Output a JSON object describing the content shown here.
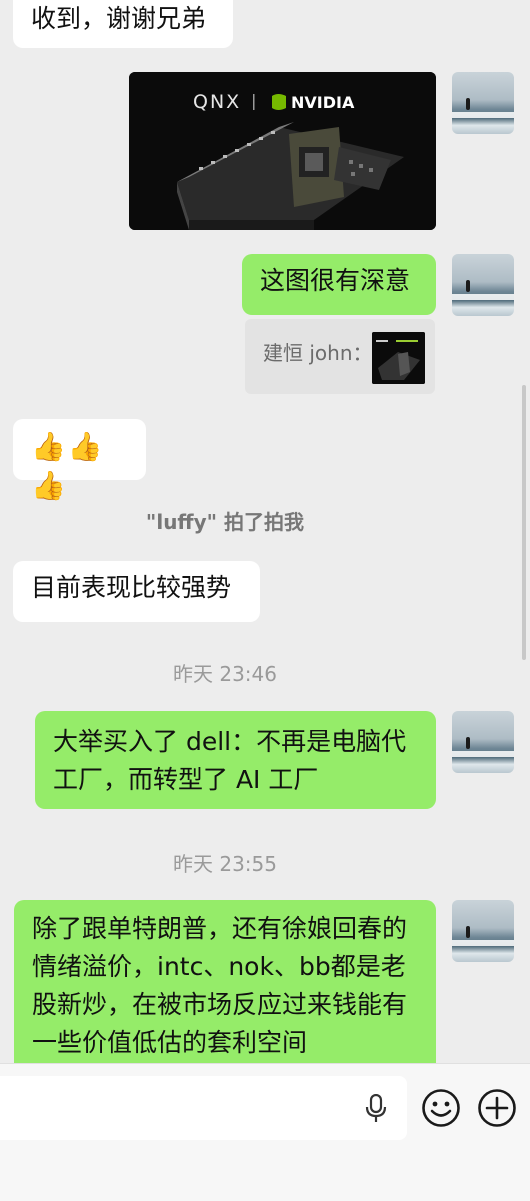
{
  "messages": {
    "m1_text": "收到，谢谢兄弟",
    "image_msg": {
      "logo_left": "QNX",
      "logo_right": "NVIDIA"
    },
    "m2_text": "这图很有深意",
    "quote_text": "建恒 john：",
    "m3_emoji": "👍👍👍",
    "system_pat": "\"luffy\" 拍了拍我",
    "m4_text": "目前表现比较强势",
    "time1": "昨天 23:46",
    "m5_text": "大举买入了 dell：不再是电脑代工厂，而转型了 AI 工厂",
    "time2": "昨天 23:55",
    "m6_text": "除了跟单特朗普，还有徐娘回春的情绪溢价，intc、nok、bb都是老股新炒，在被市场反应过来钱能有一些价值低估的套利空间"
  },
  "input": {
    "icons": [
      "microphone-icon",
      "emoji-icon",
      "plus-icon"
    ]
  },
  "colors": {
    "background": "#ededed",
    "sent_bubble": "#95ec69",
    "received_bubble": "#ffffff",
    "timestamp": "#9a9a9a"
  }
}
